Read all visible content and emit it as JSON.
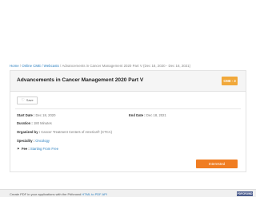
{
  "breadcrumb": {
    "items": [
      "Home",
      "Online CME / Webcasts",
      "Advancements in Cancer Management 2020 Part V (Dec 18, 2020 - Dec 18, 2021)"
    ],
    "separator": "/"
  },
  "event": {
    "title": "Advancements in Cancer Management 2020 Part V",
    "badge": "CME - 3",
    "save_label": "Save",
    "fields": {
      "start_date": {
        "label": "Start Date :",
        "value": "Dec 18, 2020"
      },
      "end_date": {
        "label": "End Date :",
        "value": "Dec 18, 2021"
      },
      "duration": {
        "label": "Duration :",
        "value": "180 Minutes"
      },
      "organized_by": {
        "label": "Organized by :",
        "value": "Cancer Treatment Centers of America® (CTCA)"
      },
      "speciality": {
        "label": "Speciality :",
        "value": "Oncology"
      },
      "fee": {
        "label": "Fee :",
        "value": "Starting From Free"
      }
    },
    "interested_label": "Interested"
  },
  "footer": {
    "text_before": "Create PDF in your applications with the Pdfcrowd",
    "link_text": "HTML to PDF API",
    "logo_text": "PDFCROWD"
  },
  "colors": {
    "link": "#2a7fbf",
    "badge": "#f1a83a",
    "primary_button": "#f07d22"
  }
}
